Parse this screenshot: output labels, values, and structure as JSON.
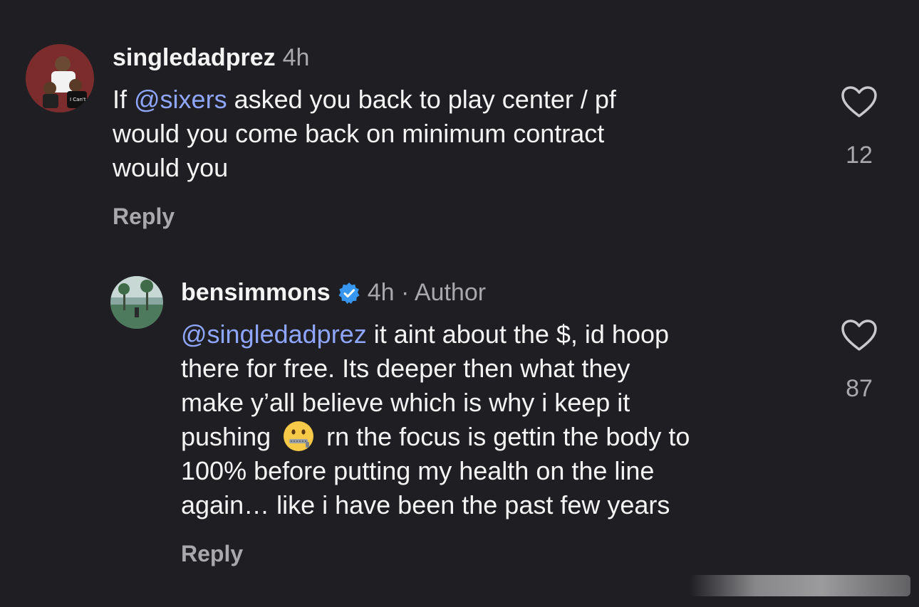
{
  "comments": [
    {
      "username": "singledadprez",
      "time": "4h",
      "author_badge": "",
      "text_lines": [
        {
          "pre": "If ",
          "mention": "@sixers",
          "post": " asked you back to play center / pf"
        },
        {
          "pre": "would you come back on minimum contract",
          "mention": "",
          "post": ""
        },
        {
          "pre": "would you",
          "mention": "",
          "post": ""
        }
      ],
      "likes": "12",
      "reply_label": "Reply",
      "avatar_icon": "user-photo-avatar"
    },
    {
      "username": "bensimmons",
      "time": "4h · Author",
      "verified": true,
      "text_lines": [
        {
          "pre": "",
          "mention": "@singledadprez",
          "post": " it aint about the $, id hoop"
        },
        {
          "pre": "there for free. Its deeper then what they",
          "mention": "",
          "post": ""
        },
        {
          "pre": "make y’all believe which is why i keep it",
          "mention": "",
          "post": ""
        },
        {
          "pre": "pushing ",
          "emoji": "zipper-mouth-face",
          "post": " rn the focus is gettin the body to"
        },
        {
          "pre": "100% before putting my health on the line",
          "mention": "",
          "post": ""
        },
        {
          "pre": "again… like i have been the past few years",
          "mention": "",
          "post": ""
        }
      ],
      "likes": "87",
      "reply_label": "Reply",
      "avatar_icon": "landscape-avatar"
    }
  ],
  "colors": {
    "background": "#1f1f23",
    "mention": "#8fa6ff",
    "muted": "#a8a8ad",
    "verified": "#3797f0"
  }
}
